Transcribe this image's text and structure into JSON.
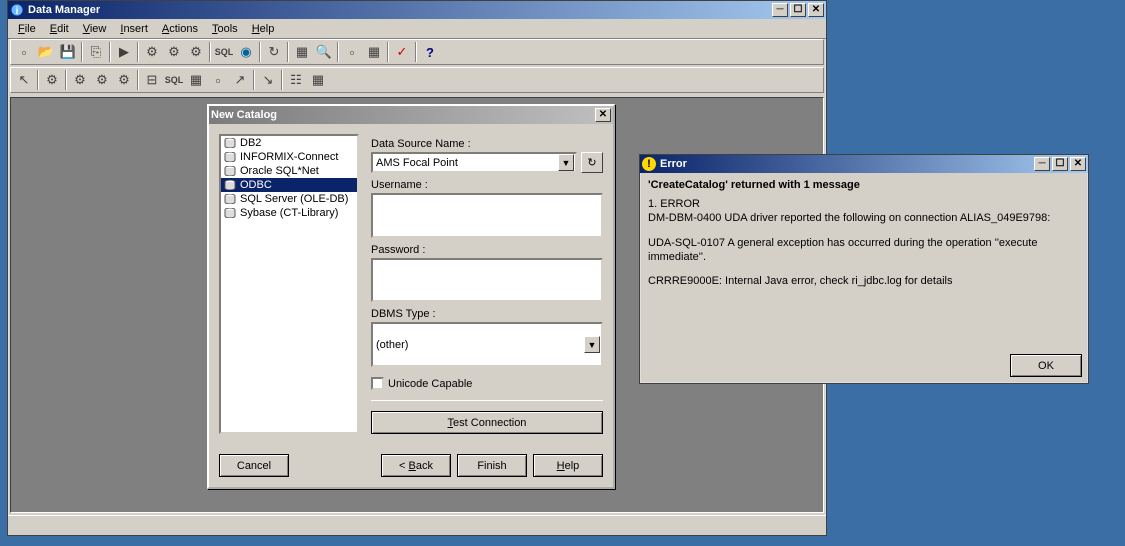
{
  "main_window": {
    "title": "Data Manager",
    "menus": [
      "File",
      "Edit",
      "View",
      "Insert",
      "Actions",
      "Tools",
      "Help"
    ]
  },
  "new_catalog": {
    "title": "New Catalog",
    "types": [
      "DB2",
      "INFORMIX-Connect",
      "Oracle SQL*Net",
      "ODBC",
      "SQL Server (OLE-DB)",
      "Sybase (CT-Library)"
    ],
    "selected_index": 3,
    "labels": {
      "dsn": "Data Source Name :",
      "user": "Username :",
      "pass": "Password :",
      "dbms": "DBMS Type :",
      "unicode": "Unicode Capable",
      "test": "Test Connection",
      "cancel": "Cancel",
      "back": "< Back",
      "finish": "Finish",
      "help": "Help"
    },
    "dsn_value": "AMS Focal Point",
    "user_value": "",
    "pass_value": "",
    "dbms_value": "(other)"
  },
  "error": {
    "title": "Error",
    "header": "'CreateCatalog' returned with 1 message",
    "line1": "1. ERROR",
    "line2": "DM-DBM-0400 UDA driver reported the following on connection ALIAS_049E9798:",
    "line3": "UDA-SQL-0107 A general exception has occurred during the operation ''execute immediate''.",
    "line4": "CRRRE9000E: Internal Java error, check ri_jdbc.log for details",
    "ok": "OK"
  }
}
